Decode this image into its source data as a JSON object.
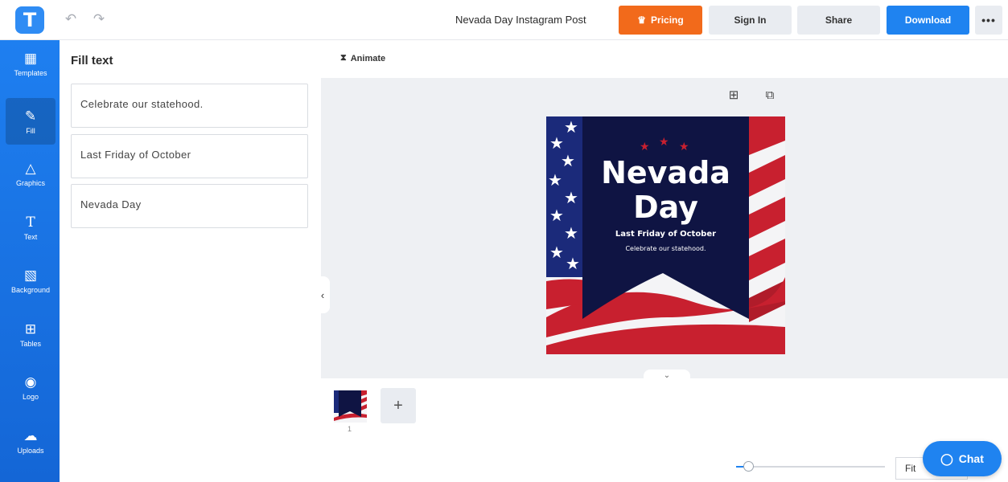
{
  "header": {
    "logo_letter": "T",
    "undo_icon": "undo-icon",
    "redo_icon": "redo-icon",
    "doc_title": "Nevada Day Instagram Post",
    "pricing_label": "Pricing",
    "signin_label": "Sign In",
    "share_label": "Share",
    "download_label": "Download",
    "more_label": "•••",
    "accent_orange": "#f26a1b",
    "accent_blue": "#1f83f0"
  },
  "sidebar": {
    "items": [
      {
        "label": "Templates",
        "icon": "templates-icon"
      },
      {
        "label": "Fill",
        "icon": "pencil-icon"
      },
      {
        "label": "Graphics",
        "icon": "shapes-icon"
      },
      {
        "label": "Text",
        "icon": "text-icon"
      },
      {
        "label": "Background",
        "icon": "background-icon"
      },
      {
        "label": "Tables",
        "icon": "table-icon"
      },
      {
        "label": "Logo",
        "icon": "logo-icon"
      },
      {
        "label": "Uploads",
        "icon": "upload-icon"
      }
    ],
    "active": "Fill"
  },
  "panel": {
    "title": "Fill text",
    "fields": [
      {
        "value": "Celebrate our statehood."
      },
      {
        "value": "Last Friday of October"
      },
      {
        "value": "Nevada Day"
      }
    ]
  },
  "canvas": {
    "animate_label": "Animate",
    "design": {
      "title_line1": "Nevada",
      "title_line2": "Day",
      "subtitle": "Last Friday of October",
      "tagline": "Celebrate our statehood.",
      "navy": "#0f1443",
      "red": "#c8202f"
    },
    "page_number": "1",
    "add_page_label": "+"
  },
  "footer": {
    "fit_label": "Fit",
    "zoom_level": 0.08,
    "chat_label": "Chat"
  }
}
